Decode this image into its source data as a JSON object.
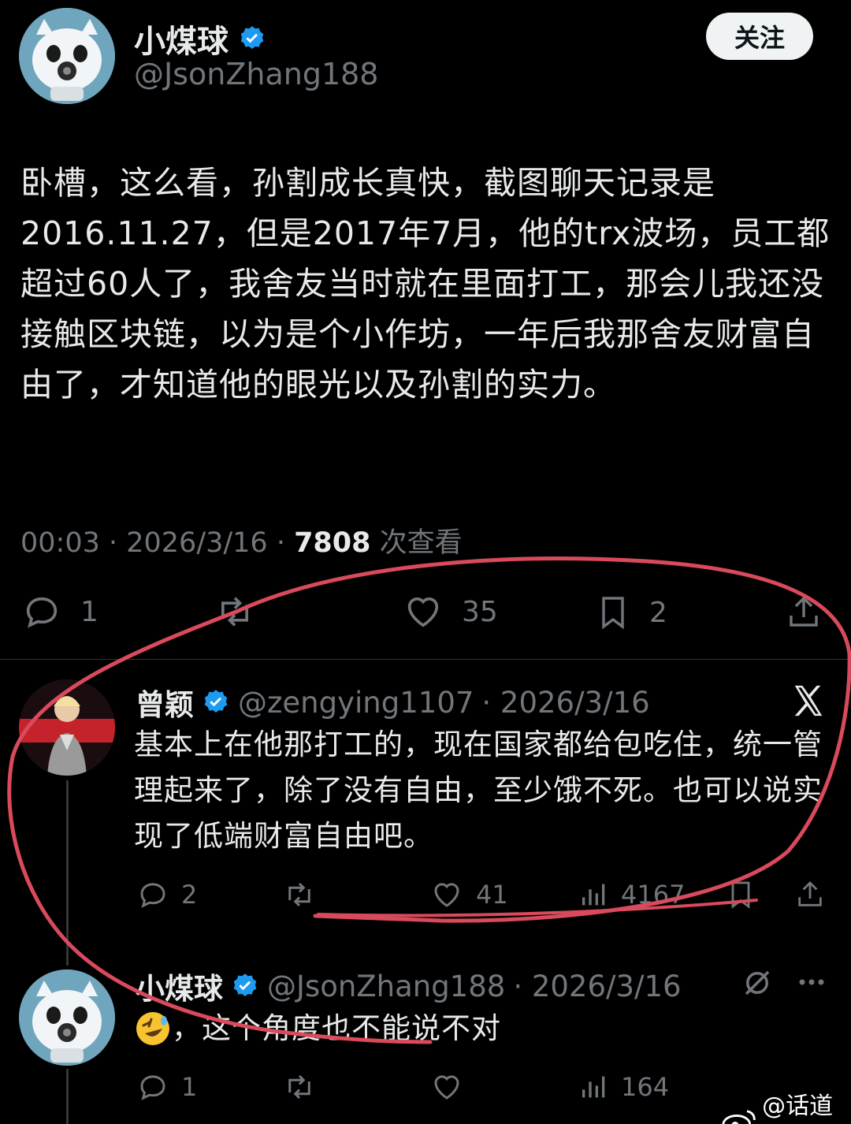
{
  "main_tweet": {
    "display_name": "小煤球",
    "handle": "@JsonZhang188",
    "follow_label": "关注",
    "text": "卧槽，这么看，孙割成长真快，截图聊天记录是2016.11.27，但是2017年7月，他的trx波场，员工都超过60人了，我舍友当时就在里面打工，那会儿我还没接触区块链，以为是个小作坊，一年后我那舍友财富自由了，才知道他的眼光以及孙割的实力。",
    "time": "00:03 · 2026/3/16 · ",
    "views": "7808",
    "views_label": " 次查看",
    "actions": {
      "reply_count": "1",
      "like_count": "35",
      "bookmark_count": "2"
    }
  },
  "reply_1": {
    "display_name": "曾颖",
    "handle": "@zengying1107",
    "date": " · 2026/3/16",
    "text": "基本上在他那打工的，现在国家都给包吃住，统一管理起来了，除了没有自由，至少饿不死。也可以说实现了低端财富自由吧。",
    "actions": {
      "reply_count": "2",
      "like_count": "41",
      "view_count": "4167"
    }
  },
  "reply_2": {
    "display_name": "小煤球",
    "handle": "@JsonZhang188",
    "date": " · 2026/3/16",
    "text": "，这个角度也不能说不对",
    "actions": {
      "reply_count": "1",
      "view_count": "164"
    }
  },
  "watermark": "@话道君",
  "colors": {
    "background": "#000000",
    "verified": "#1d9bf0",
    "annotation": "#e0505f",
    "muted": "#71767b"
  }
}
